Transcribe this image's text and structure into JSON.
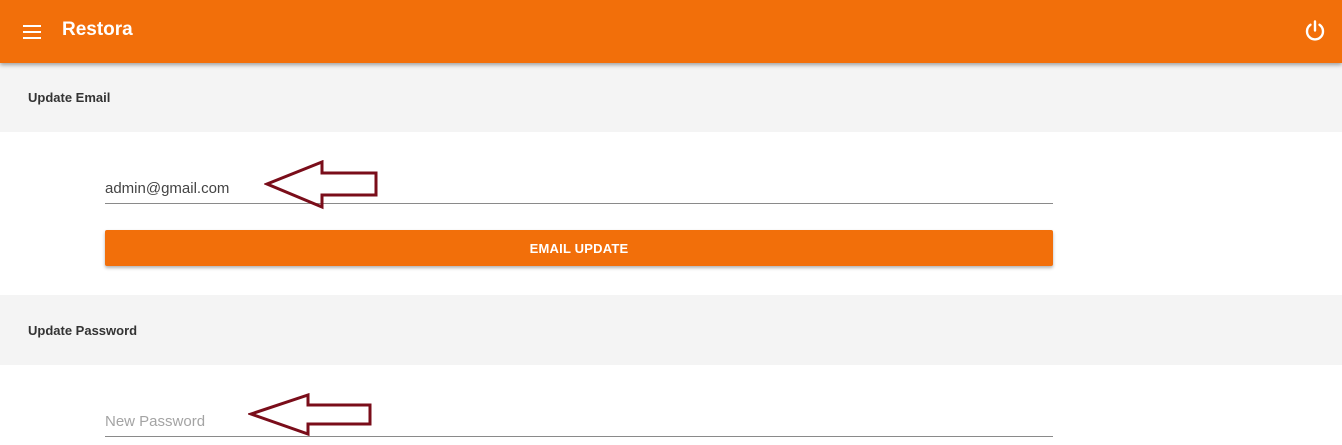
{
  "app": {
    "title": "Restora",
    "accent_color": "#f26f0a",
    "menu_icon": "menu-icon",
    "power_icon": "power-icon"
  },
  "email_section": {
    "header": "Update Email",
    "email_value": "admin@gmail.com",
    "button_label": "EMAIL UPDATE"
  },
  "password_section": {
    "header": "Update Password",
    "password_placeholder": "New Password"
  },
  "annotations": {
    "arrow_color": "#7a0d1a",
    "arrow_icon": "left-arrow-annotation"
  }
}
